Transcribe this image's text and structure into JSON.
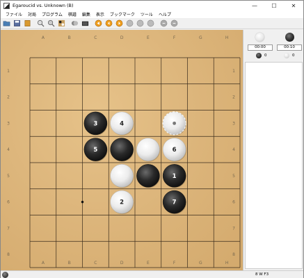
{
  "window": {
    "title": "Egaroucid vs. Unknown (B)",
    "controls": {
      "minimize": "—",
      "maximize": "☐",
      "close": "✕"
    }
  },
  "menu": [
    "ファイル",
    "対局",
    "プログラム",
    "棋譜",
    "編集",
    "表示",
    "ブックマーク",
    "ツール",
    "ヘルプ"
  ],
  "toolbar": {
    "buttons": [
      "open-icon",
      "save-icon",
      "book-icon",
      "zoom-in-icon",
      "zoom-out-icon",
      "board-icon",
      "stones-icon",
      "film-icon",
      "first-move-icon",
      "prev-move-icon",
      "next-move-icon",
      "play-icon",
      "stop-icon",
      "undo-icon",
      "redo-icon",
      "hint-icon",
      "analyze-icon"
    ]
  },
  "board": {
    "columns": [
      "A",
      "B",
      "C",
      "D",
      "E",
      "F",
      "G",
      "H"
    ],
    "rows": [
      "1",
      "2",
      "3",
      "4",
      "5",
      "6",
      "7",
      "8"
    ],
    "colors": {
      "wood": "#ddb67c",
      "line": "#3a2c1c",
      "label": "#7a6a50"
    },
    "stones": [
      {
        "col": 2,
        "row": 2,
        "color": "black",
        "label": "3"
      },
      {
        "col": 3,
        "row": 2,
        "color": "white",
        "label": "4"
      },
      {
        "col": 5,
        "row": 2,
        "color": "white",
        "label": "",
        "last": true
      },
      {
        "col": 2,
        "row": 3,
        "color": "black",
        "label": "5"
      },
      {
        "col": 3,
        "row": 3,
        "color": "black",
        "label": ""
      },
      {
        "col": 4,
        "row": 3,
        "color": "white",
        "label": ""
      },
      {
        "col": 5,
        "row": 3,
        "color": "white",
        "label": "6"
      },
      {
        "col": 3,
        "row": 4,
        "color": "white",
        "label": ""
      },
      {
        "col": 4,
        "row": 4,
        "color": "black",
        "label": ""
      },
      {
        "col": 5,
        "row": 4,
        "color": "black",
        "label": "1"
      },
      {
        "col": 3,
        "row": 5,
        "color": "white",
        "label": "2"
      },
      {
        "col": 5,
        "row": 5,
        "color": "black",
        "label": "7"
      }
    ],
    "dots": [
      {
        "col": 2,
        "row": 5
      }
    ]
  },
  "side": {
    "black_time": "00:00",
    "white_time": "00:10",
    "black_count": "0",
    "white_count": "0"
  },
  "status": {
    "text": "8 W F3"
  }
}
